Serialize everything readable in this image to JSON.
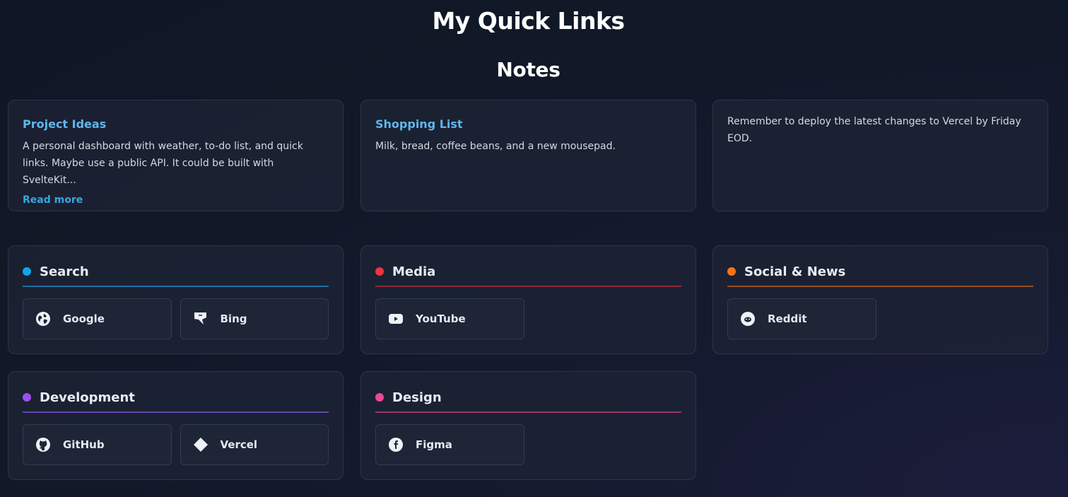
{
  "page_title": "My Quick Links",
  "notes_section": {
    "title": "Notes",
    "notes": [
      {
        "title": "Project Ideas",
        "body": "A personal dashboard with weather, to-do list, and quick links. Maybe use a public API. It could be built with SvelteKit...",
        "read_more_label": "Read more"
      },
      {
        "title": "Shopping List",
        "body": "Milk, bread, coffee beans, and a new mousepad."
      },
      {
        "body": "Remember to deploy the latest changes to Vercel by Friday EOD."
      }
    ]
  },
  "groups": [
    {
      "title": "Search",
      "accent": "#0ea5e9",
      "line_color": "#1e6fa8",
      "links": [
        {
          "label": "Google",
          "icon": "globe-icon"
        },
        {
          "label": "Bing",
          "icon": "bing-icon"
        }
      ]
    },
    {
      "title": "Media",
      "accent": "#ef3340",
      "line_color": "#8c2a36",
      "links": [
        {
          "label": "YouTube",
          "icon": "youtube-icon"
        }
      ]
    },
    {
      "title": "Social & News",
      "accent": "#f97316",
      "line_color": "#96501f",
      "links": [
        {
          "label": "Reddit",
          "icon": "reddit-icon"
        }
      ]
    },
    {
      "title": "Development",
      "accent": "#9d4ef2",
      "line_color": "#6644b3",
      "links": [
        {
          "label": "GitHub",
          "icon": "github-icon"
        },
        {
          "label": "Vercel",
          "icon": "vercel-icon"
        }
      ]
    },
    {
      "title": "Design",
      "accent": "#ec4899",
      "line_color": "#9a3464",
      "links": [
        {
          "label": "Figma",
          "icon": "figma-icon"
        }
      ]
    }
  ]
}
